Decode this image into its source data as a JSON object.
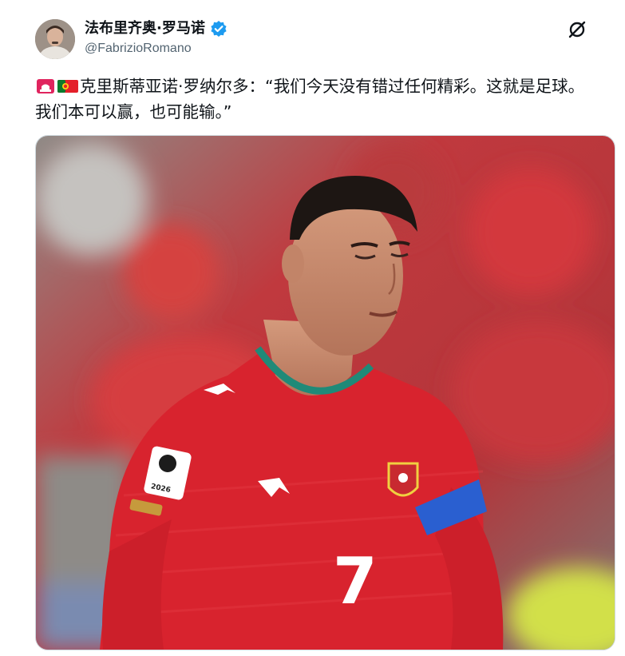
{
  "author": {
    "display_name": "法布里齐奥·罗马诺",
    "handle": "@FabrizioRomano",
    "verified": true,
    "avatar_icon": "profile-photo"
  },
  "actions": {
    "grok_icon": "grok-slash-icon"
  },
  "tweet": {
    "emoji_siren": "siren-emoji",
    "emoji_flag": "portugal-flag-emoji",
    "text": "克里斯蒂亚诺·罗纳尔多：“我们今天没有错过任何精彩。这就是足球。我们本可以赢，也可能输。”"
  },
  "media": {
    "jersey_number": "7",
    "badge_year": "2026",
    "colors": {
      "jersey": "#d8202c",
      "trim": "#1f8a78",
      "armband": "#2a5fd0",
      "background": "#b23a3e"
    }
  }
}
